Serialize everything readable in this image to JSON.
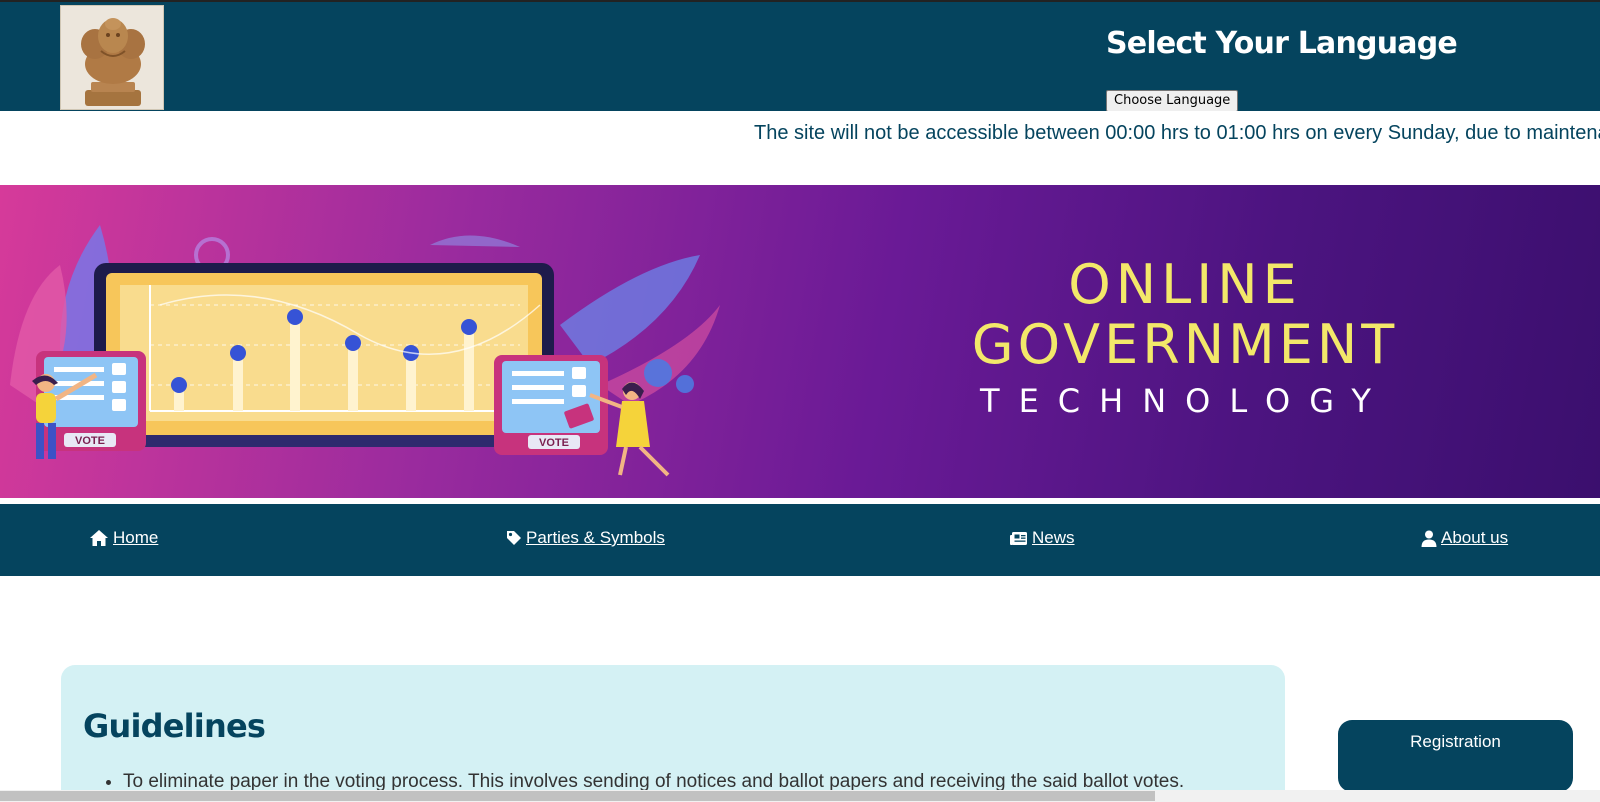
{
  "header": {
    "emblem_icon": "national-emblem-icon",
    "language_title": "Select Your Language",
    "language_button": "Choose Language",
    "background_color": "#05445e"
  },
  "notice": {
    "text": "The site will not be accessible between 00:00 hrs to 01:00 hrs on every Sunday, due to maintena"
  },
  "banner": {
    "line1": "ONLINE",
    "line2": "GOVERNMENT",
    "line3": "TECHNOLOGY",
    "vote_left": "VOTE",
    "vote_right": "VOTE",
    "title_color": "#f3e86a"
  },
  "nav": {
    "items": [
      {
        "label": "Home",
        "icon": "home-icon"
      },
      {
        "label": "Parties & Symbols",
        "icon": "tag-icon"
      },
      {
        "label": "News",
        "icon": "newspaper-icon"
      },
      {
        "label": "About us",
        "icon": "user-icon"
      }
    ]
  },
  "guidelines": {
    "title": "Guidelines",
    "items": [
      "To eliminate paper in the voting process. This involves sending of notices and ballot papers and receiving the said ballot votes."
    ],
    "background_color": "#d4f1f4"
  },
  "sidebar": {
    "registration_label": "Registration"
  }
}
